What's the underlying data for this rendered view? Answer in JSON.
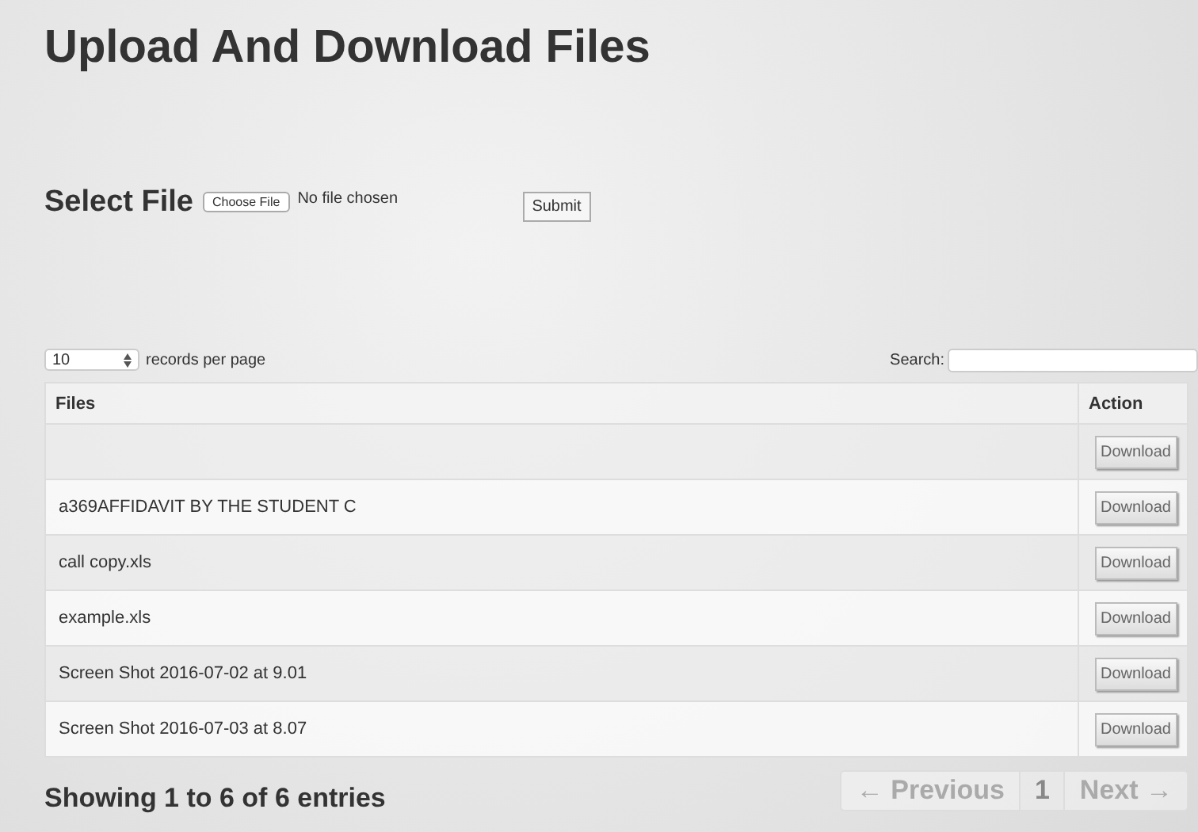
{
  "title": "Upload And Download Files",
  "upload": {
    "label": "Select File",
    "choose_button": "Choose File",
    "file_status": "No file chosen",
    "submit_button": "Submit"
  },
  "length_menu": {
    "value": "10",
    "label": "records per page"
  },
  "search": {
    "label": "Search:"
  },
  "table": {
    "columns": [
      "Files",
      "Action"
    ],
    "rows": [
      {
        "action": "Download"
      },
      {
        "file": "a369AFFIDAVIT BY THE STUDENT C",
        "action": "Download"
      },
      {
        "file": "call copy.xls",
        "action": "Download"
      },
      {
        "file": "example.xls",
        "action": "Download"
      },
      {
        "file": "Screen Shot 2016-07-02 at 9.01",
        "action": "Download"
      },
      {
        "file": "Screen Shot 2016-07-03 at 8.07",
        "action": "Download"
      }
    ]
  },
  "info": "Showing 1 to 6 of 6 entries",
  "pagination": [
    {
      "label": "← Previous",
      "disabled": true,
      "selected": false
    },
    {
      "label": "1",
      "disabled": false,
      "selected": true
    },
    {
      "label": "Next →",
      "disabled": true,
      "selected": false
    }
  ]
}
